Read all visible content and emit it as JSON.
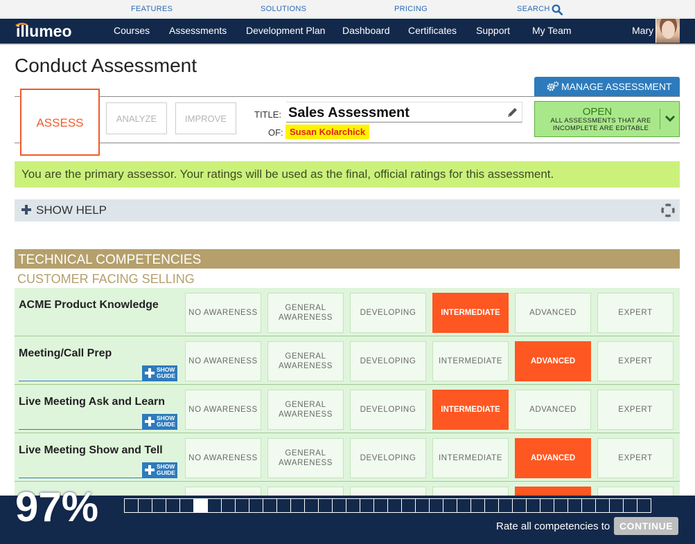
{
  "top_links": {
    "features": "FEATURES",
    "solutions": "SOLUTIONS",
    "pricing": "PRICING",
    "search": "SEARCH"
  },
  "nav": {
    "logo": "illumeo",
    "items": [
      "Courses",
      "Assessments",
      "Development Plan",
      "Dashboard",
      "Certificates",
      "Support",
      "My Team"
    ],
    "user": "Mary"
  },
  "page": {
    "title": "Conduct Assessment"
  },
  "manage_button": "MANAGE ASSESSMENT",
  "tabs": {
    "assess": "ASSESS",
    "analyze": "ANALYZE",
    "improve": "IMPROVE"
  },
  "assessment": {
    "title_label": "TITLE:",
    "title": "Sales Assessment",
    "of_label": "OF:",
    "of_name": "Susan Kolarchick"
  },
  "status": {
    "state": "OPEN",
    "note": "ALL ASSESSMENTS THAT ARE INCOMPLETE ARE EDITABLE"
  },
  "notice": "You are the primary assessor. Your ratings will be used as the final, official ratings for this assessment.",
  "help": "SHOW HELP",
  "section": {
    "title": "TECHNICAL COMPETENCIES",
    "subcategory": "CUSTOMER FACING SELLING"
  },
  "levels": [
    "NO AWARENESS",
    "GENERAL AWARENESS",
    "DEVELOPING",
    "INTERMEDIATE",
    "ADVANCED",
    "EXPERT"
  ],
  "guide_label": "SHOW GUIDE",
  "competencies": [
    {
      "name": "ACME Product Knowledge",
      "rating": "INTERMEDIATE",
      "guide": false
    },
    {
      "name": "Meeting/Call Prep",
      "rating": "ADVANCED",
      "guide": true
    },
    {
      "name": "Live Meeting Ask and Learn",
      "rating": "INTERMEDIATE",
      "guide": true
    },
    {
      "name": "Live Meeting Show and Tell",
      "rating": "ADVANCED",
      "guide": true
    },
    {
      "name": "",
      "rating": "ADVANCED",
      "guide": false
    }
  ],
  "footer": {
    "percent": "97%",
    "progress_total": 38,
    "progress_current": 6,
    "rate_text": "Rate all competencies to",
    "continue": "CONTINUE"
  },
  "colors": {
    "navy": "#13294b",
    "accent": "#ff5722",
    "notice": "#cbf17b",
    "gold": "#b5a06c",
    "status": "#a9e88a"
  }
}
